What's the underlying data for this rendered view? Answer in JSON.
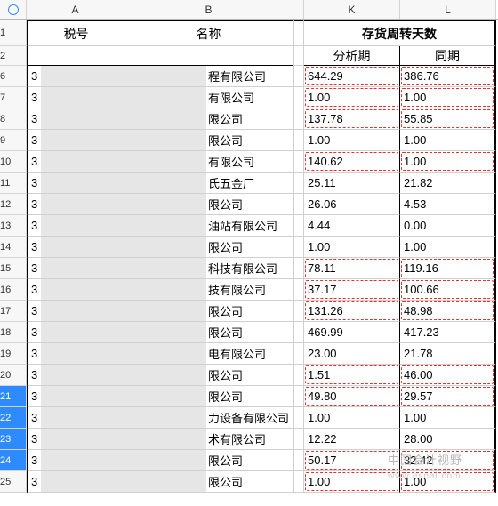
{
  "columns": {
    "A": "A",
    "B": "B",
    "K": "K",
    "L": "L"
  },
  "header": {
    "tax_no": "税号",
    "name": "名称",
    "group": "存货周转天数",
    "analysis": "分析期",
    "same_period": "同期"
  },
  "row_labels": [
    "1",
    "2",
    "6",
    "7",
    "8",
    "9",
    "10",
    "11",
    "12",
    "13",
    "14",
    "15",
    "16",
    "17",
    "18",
    "19",
    "20",
    "21",
    "22",
    "23",
    "24",
    "25"
  ],
  "chart_data": {
    "type": "table",
    "columns": [
      "税号",
      "名称",
      "存货周转天数-分析期",
      "存货周转天数-同期"
    ],
    "rows": [
      {
        "a": "3",
        "b": "程有限公司",
        "k": "644.29",
        "l": "386.76",
        "hk": true,
        "hl": true
      },
      {
        "a": "3",
        "b": "有限公司",
        "k": "1.00",
        "l": "1.00",
        "hk": true,
        "hl": true
      },
      {
        "a": "3",
        "b": "限公司",
        "k": "137.78",
        "l": "55.85",
        "hk": true,
        "hl": true
      },
      {
        "a": "3",
        "b": "限公司",
        "k": "1.00",
        "l": "1.00",
        "hk": false,
        "hl": false
      },
      {
        "a": "3",
        "b": "有限公司",
        "k": "140.62",
        "l": "1.00",
        "hk": true,
        "hl": true
      },
      {
        "a": "3",
        "b": "氏五金厂",
        "k": "25.11",
        "l": "21.82",
        "hk": false,
        "hl": false
      },
      {
        "a": "3",
        "b": "限公司",
        "k": "26.06",
        "l": "4.53",
        "hk": false,
        "hl": false
      },
      {
        "a": "3",
        "b": "油站有限公司",
        "k": "4.44",
        "l": "0.00",
        "hk": false,
        "hl": false
      },
      {
        "a": "3",
        "b": "限公司",
        "k": "1.00",
        "l": "1.00",
        "hk": false,
        "hl": false
      },
      {
        "a": "3",
        "b": "科技有限公司",
        "k": "78.11",
        "l": "119.16",
        "hk": true,
        "hl": true
      },
      {
        "a": "3",
        "b": "技有限公司",
        "k": "37.17",
        "l": "100.66",
        "hk": true,
        "hl": true
      },
      {
        "a": "3",
        "b": "限公司",
        "k": "131.26",
        "l": "48.98",
        "hk": true,
        "hl": true
      },
      {
        "a": "3",
        "b": "限公司",
        "k": "469.99",
        "l": "417.23",
        "hk": false,
        "hl": false
      },
      {
        "a": "3",
        "b": "电有限公司",
        "k": "23.00",
        "l": "21.78",
        "hk": false,
        "hl": false
      },
      {
        "a": "3",
        "b": "限公司",
        "k": "1.51",
        "l": "46.00",
        "hk": true,
        "hl": true
      },
      {
        "a": "3",
        "b": "限公司",
        "k": "49.80",
        "l": "29.57",
        "hk": true,
        "hl": true
      },
      {
        "a": "3",
        "b": "力设备有限公司",
        "k": "1.00",
        "l": "1.00",
        "hk": false,
        "hl": false
      },
      {
        "a": "3",
        "b": "术有限公司",
        "k": "12.22",
        "l": "28.00",
        "hk": false,
        "hl": false
      },
      {
        "a": "3",
        "b": "限公司",
        "k": "50.17",
        "l": "32.42",
        "hk": true,
        "hl": true
      },
      {
        "a": "3",
        "b": "限公司",
        "k": "1.00",
        "l": "1.00",
        "hk": true,
        "hl": true
      }
    ]
  },
  "selected_rows": [
    21,
    22,
    23,
    24
  ],
  "watermark": "中国会计视野",
  "watermark_sub": "www.esnai.com"
}
